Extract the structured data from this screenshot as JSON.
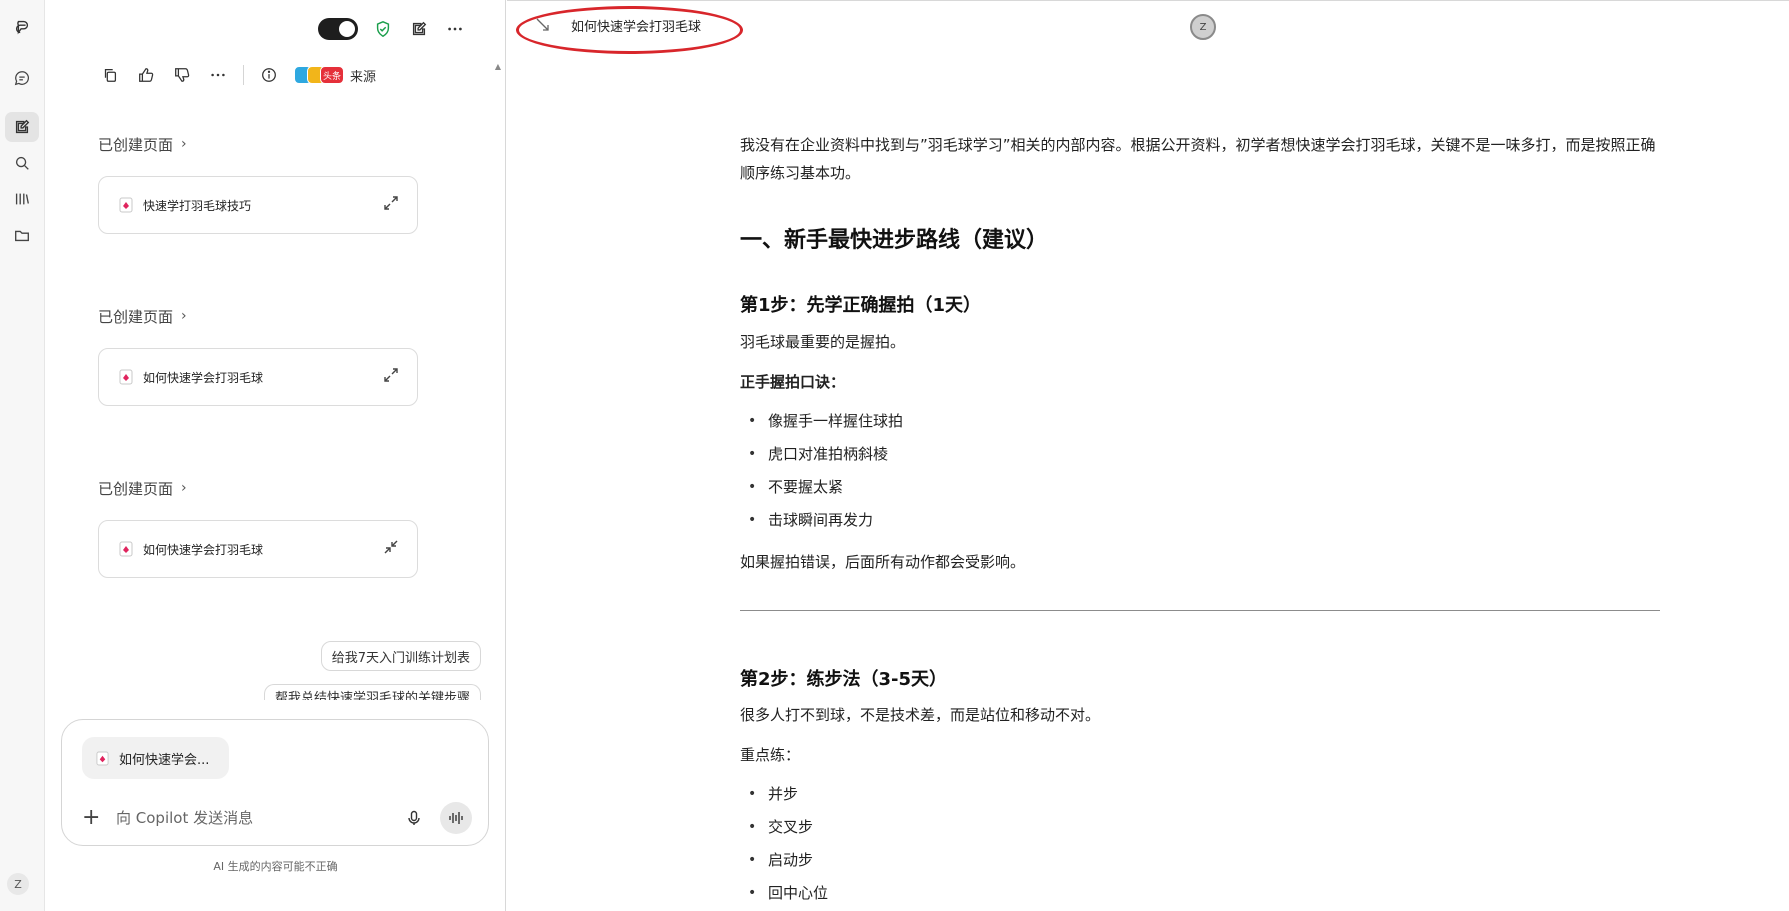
{
  "rail": {
    "avatar": "Z"
  },
  "chat": {
    "sources_label": "来源",
    "source_badge": "头条",
    "created_pages": [
      {
        "title": "已创建页面",
        "card": "快速学打羽毛球技巧",
        "state": "expand"
      },
      {
        "title": "已创建页面",
        "card": "如何快速学会打羽毛球",
        "state": "expand"
      },
      {
        "title": "已创建页面",
        "card": "如何快速学会打羽毛球",
        "state": "collapse"
      }
    ],
    "suggestions": [
      "给我7天入门训练计划表",
      "帮我总结快速学羽毛球的关键步骤"
    ],
    "composer": {
      "attachment": "如何快速学会...",
      "placeholder": "向 Copilot 发送消息"
    },
    "disclaimer": "AI 生成的内容可能不正确"
  },
  "doc": {
    "tab_title": "如何快速学会打羽毛球",
    "user_avatar": "Z",
    "intro": "我没有在企业资料中找到与”羽毛球学习”相关的内部内容。根据公开资料，初学者想快速学会打羽毛球，关键不是一味多打，而是按照正确顺序练习基本功。",
    "h1": "一、新手最快进步路线（建议）",
    "step1": {
      "heading": "第1步：先学正确握拍（1天）",
      "lead": "羽毛球最重要的是握拍。",
      "sub": "正手握拍口诀：",
      "bullets": [
        "像握手一样握住球拍",
        "虎口对准拍柄斜棱",
        "不要握太紧",
        "击球瞬间再发力"
      ],
      "after": "如果握拍错误，后面所有动作都会受影响。"
    },
    "step2": {
      "heading": "第2步：练步法（3-5天）",
      "lead": "很多人打不到球，不是技术差，而是站位和移动不对。",
      "sub": "重点练：",
      "bullets": [
        "并步",
        "交叉步",
        "启动步",
        "回中心位"
      ]
    }
  },
  "colors": {
    "accent_ring": "#d8262b",
    "shield_green": "#1a9e4b",
    "doc_icon_red": "#e0245e"
  }
}
